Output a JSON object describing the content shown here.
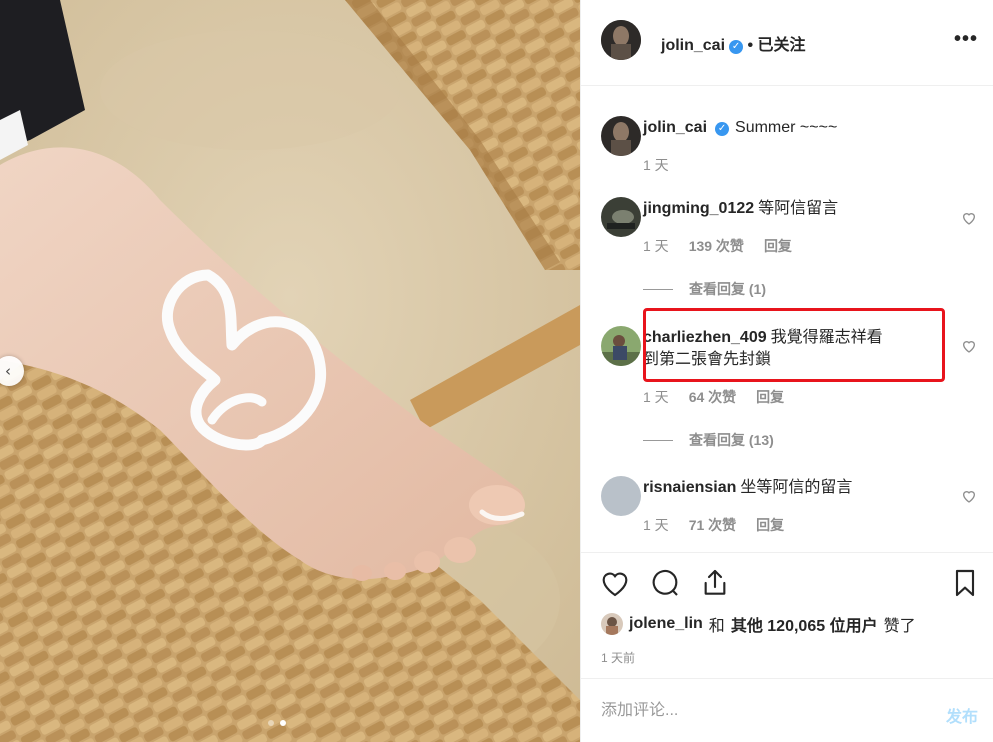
{
  "post": {
    "author": "jolin_cai",
    "follow_status": "• 已关注",
    "verified_mark": "✓",
    "more_label": "•••"
  },
  "caption": {
    "username": "jolin_cai",
    "text": "Summer ~~~~",
    "time": "1 天"
  },
  "comments": [
    {
      "username": "jingming_0122",
      "text": "等阿信留言",
      "time": "1 天",
      "likes": "139 次赞",
      "reply": "回复",
      "view_replies": "查看回复 (1)"
    },
    {
      "username": "charliezhen_409",
      "text_line1": "我覺得羅志祥看",
      "text_line2": "到第二張會先封鎖",
      "time": "1 天",
      "likes": "64 次赞",
      "reply": "回复",
      "view_replies": "查看回复 (13)"
    },
    {
      "username": "risnaiensian",
      "text": "坐等阿信的留言",
      "time": "1 天",
      "likes": "71 次赞",
      "reply": "回复"
    }
  ],
  "likes_summary": {
    "user": "jolene_lin",
    "and": "和",
    "others": "其他",
    "count": "120,065",
    "unit": "位用户",
    "suffix": "赞了"
  },
  "posted_time": "1 天前",
  "comment_box": {
    "placeholder": "添加评论...",
    "post_label": "发布"
  },
  "carousel": {
    "prev_icon": "‹",
    "slides": 2,
    "active_slide": 2
  },
  "colors": {
    "highlight": "#e8141c",
    "verified": "#3897f0",
    "muted": "#8e8e8e"
  }
}
